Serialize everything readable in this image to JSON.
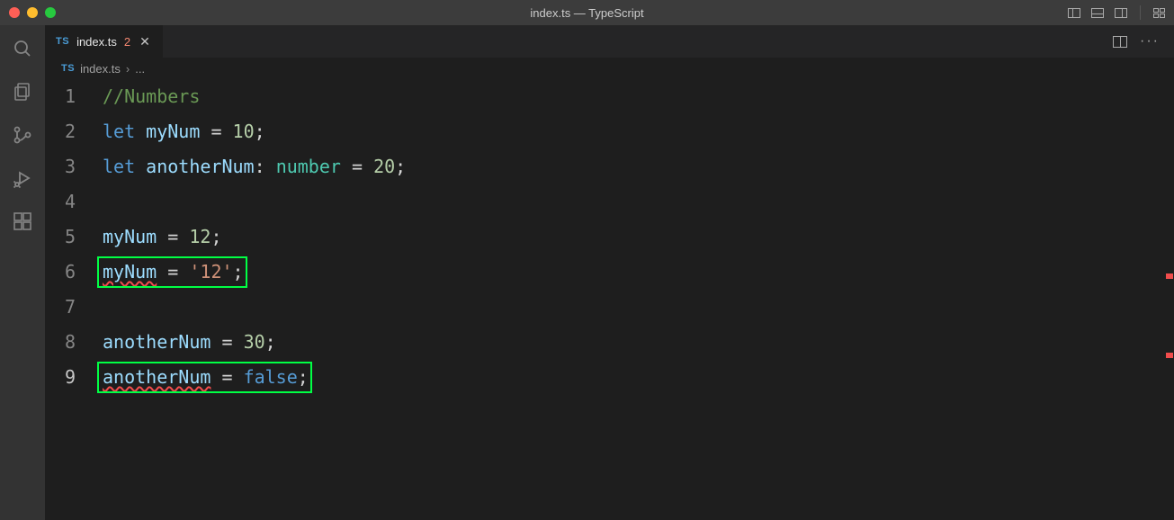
{
  "titlebar": {
    "title": "index.ts — TypeScript"
  },
  "tab": {
    "language_badge": "TS",
    "filename": "index.ts",
    "error_count": "2"
  },
  "breadcrumb": {
    "language_badge": "TS",
    "filename": "index.ts",
    "more": "..."
  },
  "code": {
    "lines": [
      {
        "num": "1",
        "tokens": [
          {
            "t": "//Numbers",
            "c": "t-comment"
          }
        ]
      },
      {
        "num": "2",
        "tokens": [
          {
            "t": "let",
            "c": "t-keyword"
          },
          {
            "t": " ",
            "c": ""
          },
          {
            "t": "myNum",
            "c": "t-var"
          },
          {
            "t": " ",
            "c": ""
          },
          {
            "t": "=",
            "c": "t-op"
          },
          {
            "t": " ",
            "c": ""
          },
          {
            "t": "10",
            "c": "t-number"
          },
          {
            "t": ";",
            "c": "t-punct"
          }
        ]
      },
      {
        "num": "3",
        "tokens": [
          {
            "t": "let",
            "c": "t-keyword"
          },
          {
            "t": " ",
            "c": ""
          },
          {
            "t": "anotherNum",
            "c": "t-var"
          },
          {
            "t": ":",
            "c": "t-punct"
          },
          {
            "t": " ",
            "c": ""
          },
          {
            "t": "number",
            "c": "t-type"
          },
          {
            "t": " ",
            "c": ""
          },
          {
            "t": "=",
            "c": "t-op"
          },
          {
            "t": " ",
            "c": ""
          },
          {
            "t": "20",
            "c": "t-number"
          },
          {
            "t": ";",
            "c": "t-punct"
          }
        ]
      },
      {
        "num": "4",
        "tokens": []
      },
      {
        "num": "5",
        "tokens": [
          {
            "t": "myNum",
            "c": "t-var"
          },
          {
            "t": " ",
            "c": ""
          },
          {
            "t": "=",
            "c": "t-op"
          },
          {
            "t": " ",
            "c": ""
          },
          {
            "t": "12",
            "c": "t-number"
          },
          {
            "t": ";",
            "c": "t-punct"
          }
        ]
      },
      {
        "num": "6",
        "tokens": [
          {
            "t": "myNum",
            "c": "t-var squiggle"
          },
          {
            "t": " ",
            "c": ""
          },
          {
            "t": "=",
            "c": "t-op"
          },
          {
            "t": " ",
            "c": ""
          },
          {
            "t": "'12'",
            "c": "t-string"
          },
          {
            "t": ";",
            "c": "t-punct"
          }
        ],
        "boxed": true
      },
      {
        "num": "7",
        "tokens": []
      },
      {
        "num": "8",
        "tokens": [
          {
            "t": "anotherNum",
            "c": "t-var"
          },
          {
            "t": " ",
            "c": ""
          },
          {
            "t": "=",
            "c": "t-op"
          },
          {
            "t": " ",
            "c": ""
          },
          {
            "t": "30",
            "c": "t-number"
          },
          {
            "t": ";",
            "c": "t-punct"
          }
        ]
      },
      {
        "num": "9",
        "tokens": [
          {
            "t": "anotherNum",
            "c": "t-var squiggle"
          },
          {
            "t": " ",
            "c": ""
          },
          {
            "t": "=",
            "c": "t-op"
          },
          {
            "t": " ",
            "c": ""
          },
          {
            "t": "false",
            "c": "t-const"
          },
          {
            "t": ";",
            "c": "t-punct"
          }
        ],
        "boxed": true,
        "current": true
      }
    ]
  },
  "minimap": {
    "error_positions_pct": [
      44,
      62
    ]
  },
  "colors": {
    "accent_green_box": "#00ff44",
    "error_red": "#f14c4c"
  }
}
